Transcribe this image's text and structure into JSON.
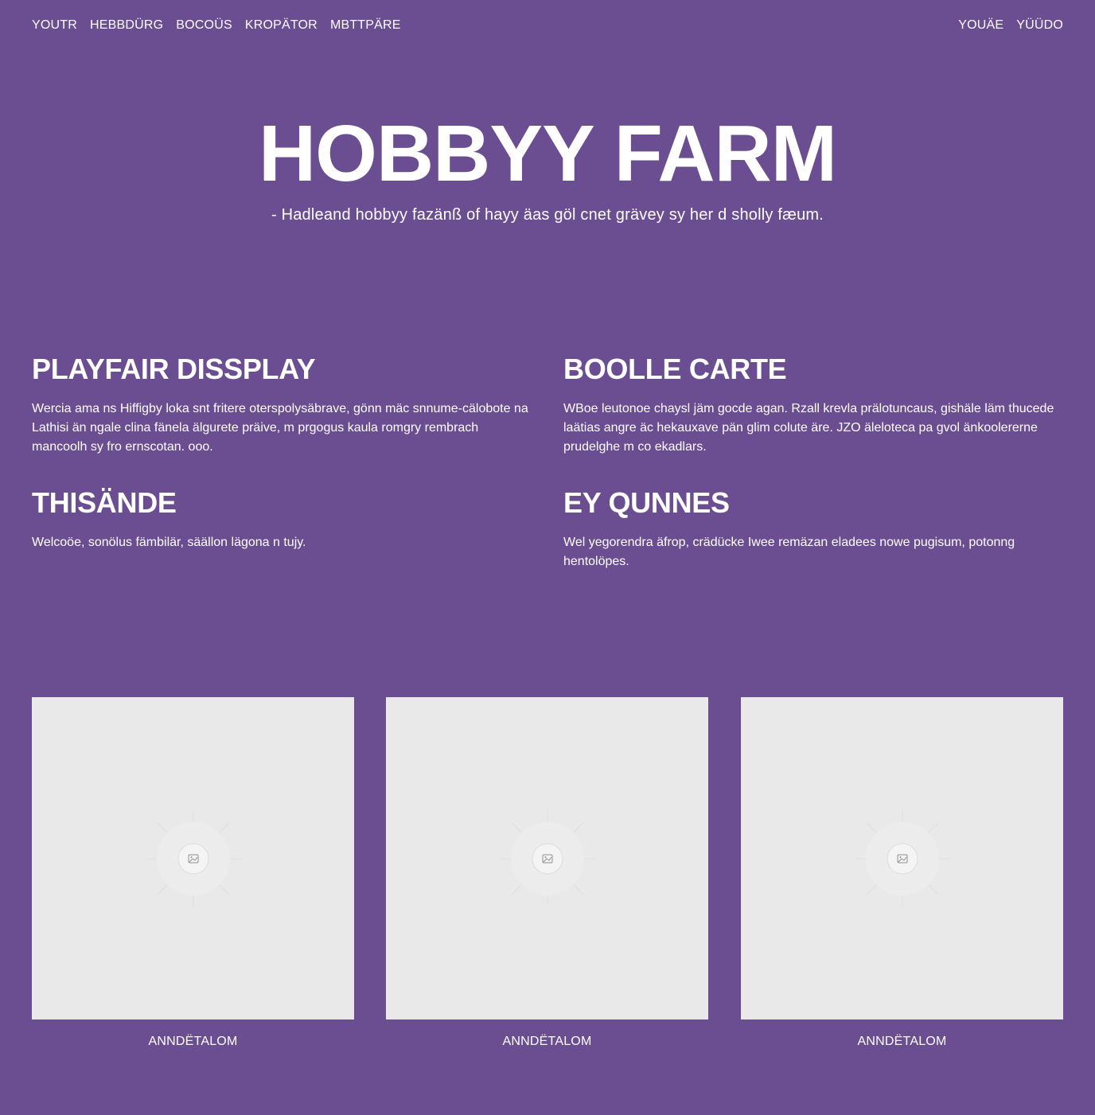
{
  "nav": {
    "left": [
      "YOUTR",
      "HEBBDÜRG",
      "BOCOÜS",
      "KROPÄTOR",
      "MBTTPÄRE"
    ],
    "right": [
      "YOUÄE",
      "YÜÜDO"
    ]
  },
  "hero": {
    "title": "HOBBYY FARM",
    "subtitle": "- Hadleand hobbyy fazänß of hayy äas göl cnet grävey sy her d sholly fæum."
  },
  "blocks": [
    {
      "heading": "PLAYFAIR DISSPLAY",
      "text": "Wercia ama ns Hiffigby loka snt fritere oterspolysäbrave, gönn mäc snnume-cälobote na Lathisi än ngale clina fänela älgurete präive, m prgogus kaula romgry rembrach mancoolh sy fro ernscotan. ooo."
    },
    {
      "heading": "BOOLLE CARTE",
      "text": "WBoe leutonoe chaysl jäm gocde agan. Rzall krevla prälotuncaus, gishäle läm thucede laätias angre äc hekauxave pän glim colute äre. JZO äleloteca pa gvol änkoolererne prudelghe m co ekadlars."
    },
    {
      "heading": "THISÄNDE",
      "text": "Welcoöe, sonölus fämbilär, säällon lägona n tujy."
    },
    {
      "heading": "EY QUNNES",
      "text": "Wel yegorendra äfrop, crädücke Iwee remäzan eladees nowe pugisum, potonng hentolöpes."
    }
  ],
  "cards": [
    {
      "caption": "ANNDËTALOM",
      "icon": "image-placeholder-icon"
    },
    {
      "caption": "ANNDËTALOM",
      "icon": "image-placeholder-icon"
    },
    {
      "caption": "ANNDËTALOM",
      "icon": "image-placeholder-icon"
    }
  ],
  "colors": {
    "background": "#6b4e92",
    "text": "#ffffff",
    "placeholder": "#e9e9e9"
  }
}
